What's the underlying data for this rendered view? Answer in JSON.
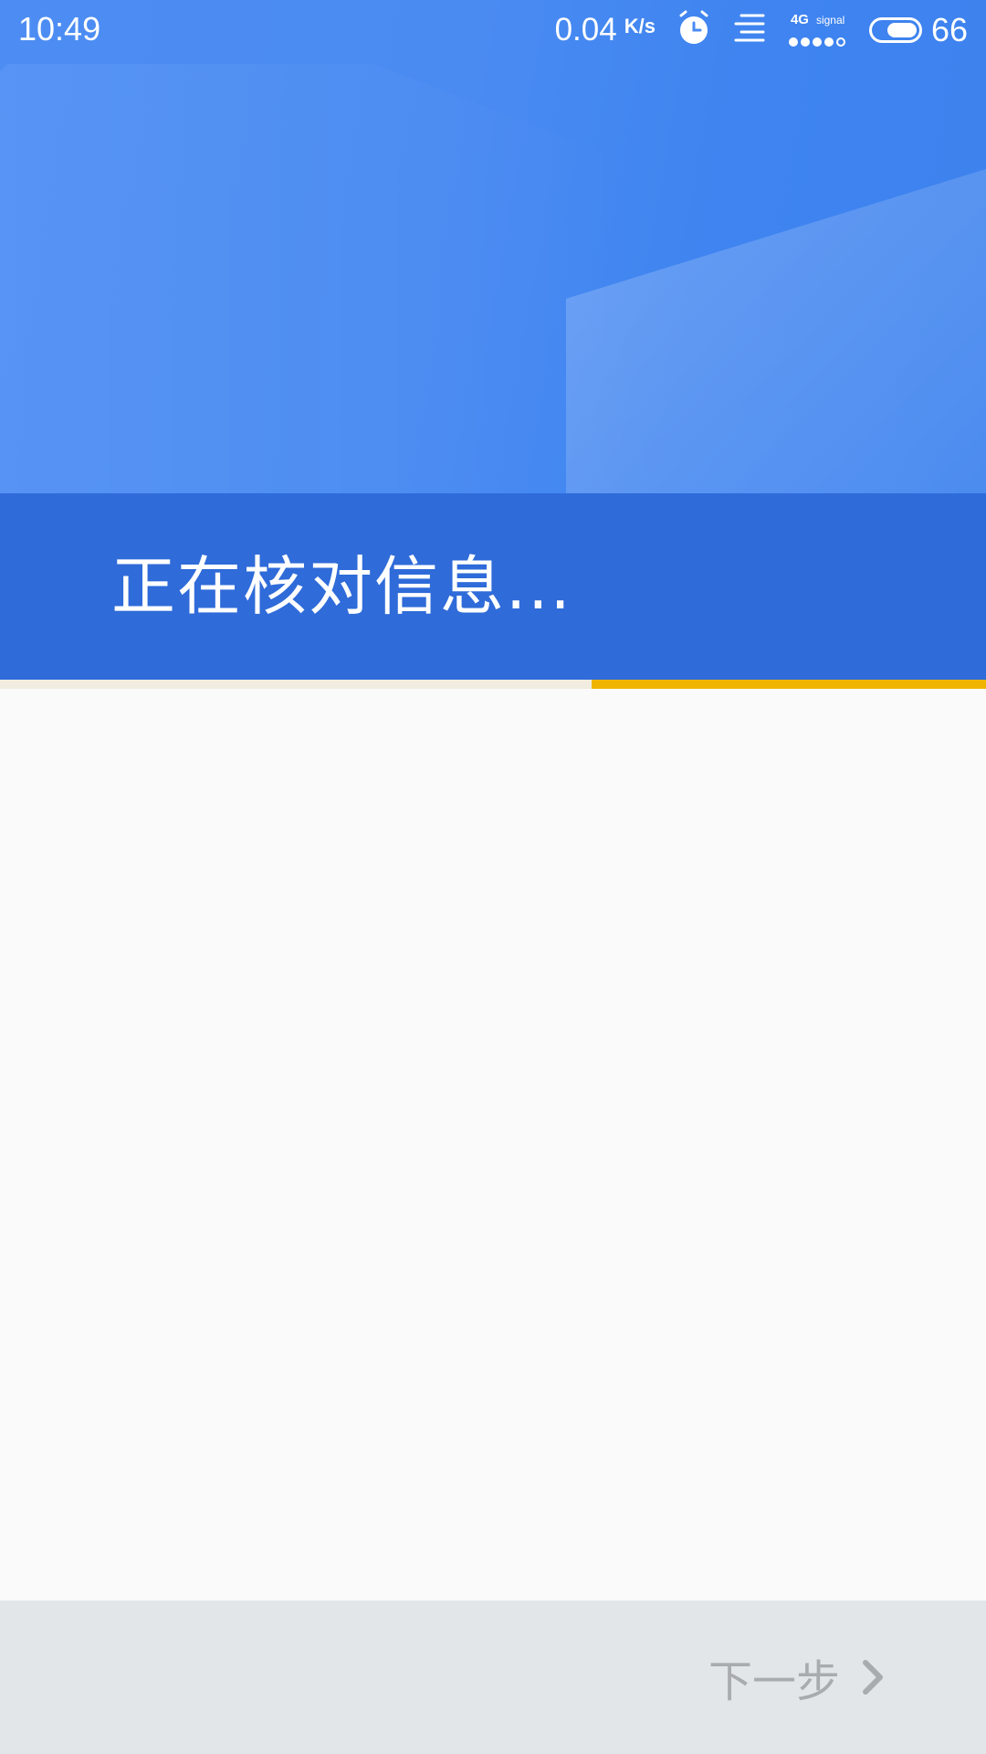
{
  "status_bar": {
    "time": "10:49",
    "net_speed": "0.04",
    "net_speed_unit": "K/s",
    "network_type": "4G",
    "signal_label": "signal",
    "signal_strength": 4,
    "signal_max": 5,
    "battery_level": "66",
    "icons": [
      "alarm-icon",
      "notification-lines-icon",
      "signal-icon",
      "battery-icon"
    ]
  },
  "header": {
    "title": "正在核对信息..."
  },
  "progress": {
    "fraction_remaining_track": 0.4,
    "color": "#efb400"
  },
  "footer": {
    "next_label": "下一步",
    "next_icon": "chevron-right-icon"
  },
  "colors": {
    "hero_blue": "#4a8bf2",
    "title_band": "#2f6bd9",
    "progress": "#efb400",
    "footer_bg": "#e3e6e8",
    "disabled_text": "#a9acae"
  }
}
